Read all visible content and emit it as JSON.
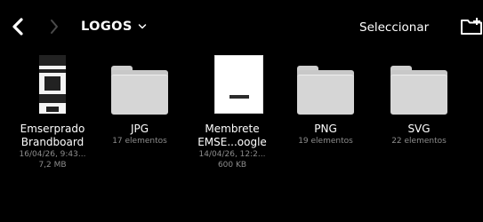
{
  "toolbar": {
    "title": "LOGOS",
    "select_label": "Seleccionar"
  },
  "icons": {
    "back": "chevron-left-icon",
    "forward": "chevron-right-icon",
    "title_dropdown": "chevron-down-icon",
    "new_folder": "folder-plus-icon"
  },
  "items": [
    {
      "kind": "document",
      "name_line1": "Emserprado",
      "name_line2": "Brandboard",
      "meta_line1": "16/04/26, 9:43...",
      "meta_line2": "7,2 MB"
    },
    {
      "kind": "folder",
      "name_line1": "JPG",
      "meta_line1": "17 elementos"
    },
    {
      "kind": "pdf",
      "name_line1": "Membrete",
      "name_line2": "EMSE...oogle",
      "meta_line1": "14/04/26, 12:2...",
      "meta_line2": "600 KB"
    },
    {
      "kind": "folder",
      "name_line1": "PNG",
      "meta_line1": "19 elementos"
    },
    {
      "kind": "folder",
      "name_line1": "SVG",
      "meta_line1": "22 elementos"
    }
  ],
  "colors": {
    "background": "#000000",
    "text": "#ffffff",
    "secondary_text": "#8c8c8c",
    "disabled_icon": "#4a4a4a",
    "folder": "#d6d6d6"
  }
}
